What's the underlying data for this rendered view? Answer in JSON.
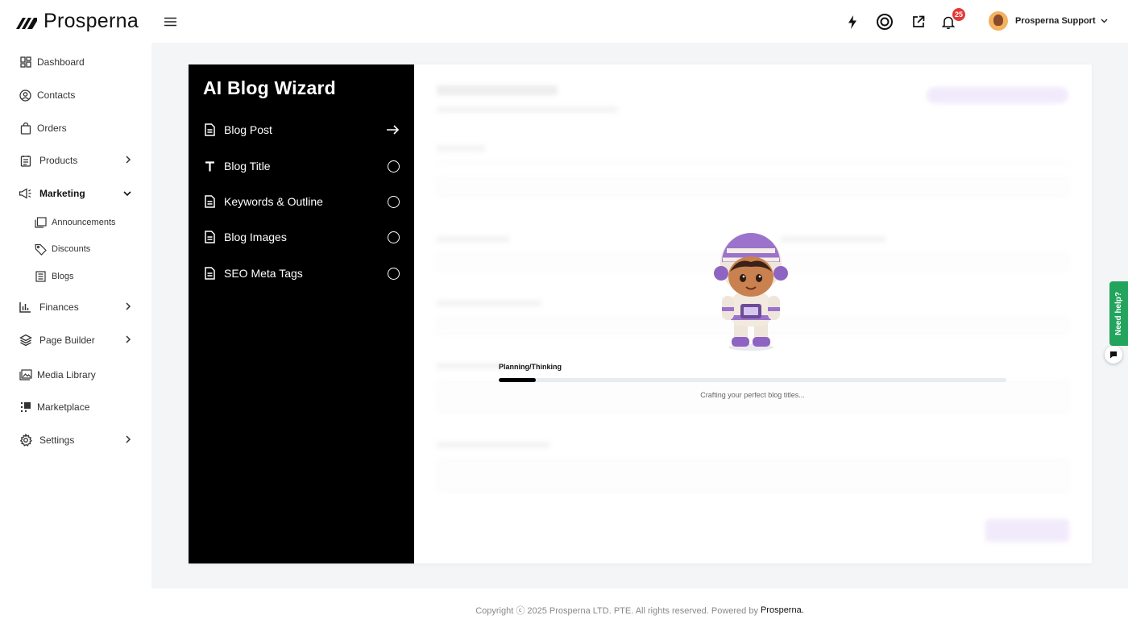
{
  "brand": {
    "name": "Prosperna"
  },
  "sidebar": {
    "items": [
      {
        "label": "Dashboard",
        "icon": "dashboard-icon"
      },
      {
        "label": "Contacts",
        "icon": "contacts-icon"
      },
      {
        "label": "Orders",
        "icon": "orders-icon"
      },
      {
        "label": "Products",
        "icon": "products-icon"
      },
      {
        "label": "Marketing",
        "icon": "megaphone-icon"
      },
      {
        "label": "Finances",
        "icon": "chart-icon"
      },
      {
        "label": "Page Builder",
        "icon": "layers-icon"
      },
      {
        "label": "Media Library",
        "icon": "image-icon"
      },
      {
        "label": "Marketplace",
        "icon": "marketplace-icon"
      },
      {
        "label": "Settings",
        "icon": "gear-icon"
      }
    ],
    "marketing_sub": [
      {
        "label": "Announcements",
        "icon": "announcement-icon"
      },
      {
        "label": "Discounts",
        "icon": "tag-icon"
      },
      {
        "label": "Blogs",
        "icon": "blog-icon"
      }
    ]
  },
  "topbar": {
    "notification_count": "25",
    "user_name": "Prosperna Support"
  },
  "wizard": {
    "title": "AI Blog Wizard",
    "steps": [
      {
        "label": "Blog Post",
        "state": "current"
      },
      {
        "label": "Blog Title",
        "state": "pending"
      },
      {
        "label": "Keywords & Outline",
        "state": "pending"
      },
      {
        "label": "Blog Images",
        "state": "pending"
      },
      {
        "label": "SEO Meta Tags",
        "state": "pending"
      }
    ]
  },
  "loader": {
    "label": "Planning/Thinking",
    "progress": 0.073,
    "caption": "Crafting your perfect blog titles..."
  },
  "footer": {
    "text": "Copyright ⓒ 2025 Prosperna LTD. PTE. All rights reserved. Powered by",
    "brand": "Prosperna."
  },
  "help": {
    "label": "Need help?"
  },
  "colors": {
    "accent": "#000000",
    "help_green": "#22a45d",
    "badge_red": "#e53935"
  }
}
